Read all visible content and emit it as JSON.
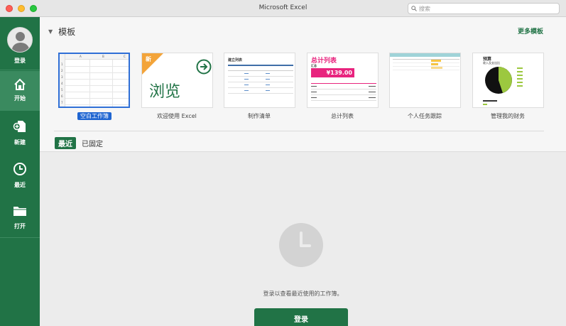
{
  "window": {
    "title": "Microsoft Excel",
    "search_placeholder": "搜索"
  },
  "sidebar": {
    "items": [
      {
        "label": "登录"
      },
      {
        "label": "开始"
      },
      {
        "label": "新建"
      },
      {
        "label": "最近"
      },
      {
        "label": "打开"
      }
    ]
  },
  "templates": {
    "heading": "模板",
    "more_label": "更多模板",
    "items": [
      {
        "label": "空白工作簿"
      },
      {
        "label": "欢迎使用 Excel",
        "badge": "新",
        "thumb_text": "浏览"
      },
      {
        "label": "制作清单",
        "thumb_title": "建立列表"
      },
      {
        "label": "总计列表",
        "thumb_title": "总计列表",
        "thumb_sub": "汇总",
        "thumb_amount": "¥139.00"
      },
      {
        "label": "个人任务跟踪"
      },
      {
        "label": "管理我的财务",
        "thumb_title": "预算",
        "thumb_sub": "收入及支出比"
      }
    ]
  },
  "tabs": {
    "recent": "最近",
    "pinned": "已固定"
  },
  "recent": {
    "message": "登录以查看最近使用的工作簿。",
    "signin_button": "登录"
  },
  "colors": {
    "brand": "#217346",
    "selection": "#1f65d1",
    "accent_pink": "#e8247e"
  }
}
